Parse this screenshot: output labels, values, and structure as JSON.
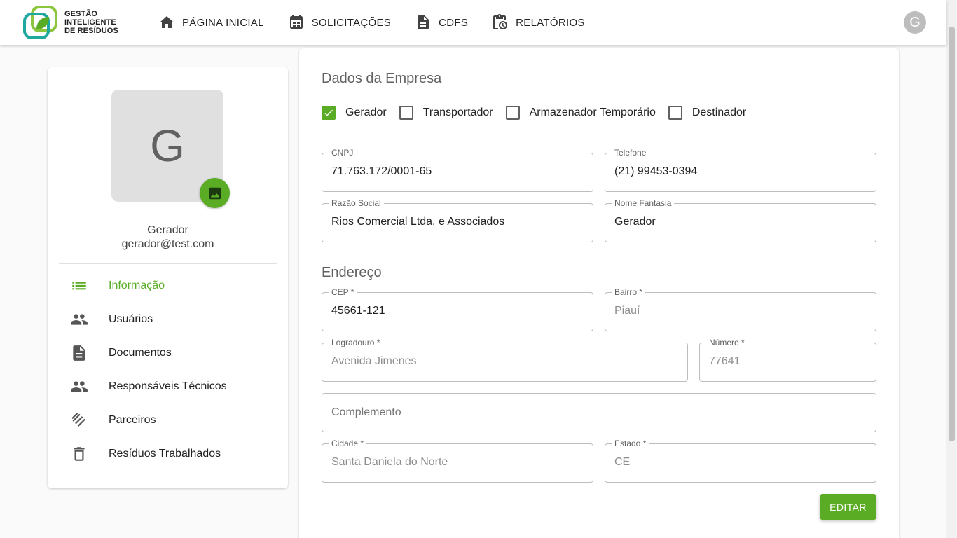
{
  "header": {
    "logo_lines": [
      "GESTÃO",
      "INTELIGENTE",
      "DE RESÍDUOS"
    ],
    "nav": [
      {
        "label": "PÁGINA INICIAL",
        "icon": "home-icon"
      },
      {
        "label": "SOLICITAÇÕES",
        "icon": "calendar-table-icon"
      },
      {
        "label": "CDFS",
        "icon": "document-icon"
      },
      {
        "label": "RELATÓRIOS",
        "icon": "clipboard-clock-icon"
      }
    ],
    "avatar_letter": "G"
  },
  "profile": {
    "avatar_letter": "G",
    "name": "Gerador",
    "email": "gerador@test.com",
    "menu": [
      {
        "label": "Informação",
        "icon": "list-icon",
        "active": true
      },
      {
        "label": "Usuários",
        "icon": "people-icon"
      },
      {
        "label": "Documentos",
        "icon": "document-icon"
      },
      {
        "label": "Responsáveis Técnicos",
        "icon": "people-icon"
      },
      {
        "label": "Parceiros",
        "icon": "handshake-icon"
      },
      {
        "label": "Resíduos Trabalhados",
        "icon": "trash-icon"
      }
    ]
  },
  "company": {
    "title": "Dados da Empresa",
    "types": [
      {
        "label": "Gerador",
        "checked": true
      },
      {
        "label": "Transportador",
        "checked": false
      },
      {
        "label": "Armazenador Temporário",
        "checked": false
      },
      {
        "label": "Destinador",
        "checked": false
      }
    ],
    "cnpj": {
      "label": "CNPJ",
      "value": "71.763.172/0001-65"
    },
    "telefone": {
      "label": "Telefone",
      "value": "(21) 99453-0394"
    },
    "razao_social": {
      "label": "Razão Social",
      "value": "Rios Comercial Ltda. e Associados"
    },
    "nome_fantasia": {
      "label": "Nome Fantasia",
      "value": "Gerador"
    }
  },
  "address": {
    "title": "Endereço",
    "cep": {
      "label": "CEP *",
      "value": "45661-121"
    },
    "bairro": {
      "label": "Bairro *",
      "value": "Piauí"
    },
    "logradouro": {
      "label": "Logradouro *",
      "value": "Avenida Jimenes"
    },
    "numero": {
      "label": "Número *",
      "value": "77641"
    },
    "complemento": {
      "placeholder": "Complemento"
    },
    "cidade": {
      "label": "Cidade *",
      "value": "Santa Daniela do Norte"
    },
    "estado": {
      "label": "Estado *",
      "value": "CE"
    }
  },
  "actions": {
    "edit_label": "EDITAR"
  },
  "colors": {
    "accent": "#5aac25"
  }
}
